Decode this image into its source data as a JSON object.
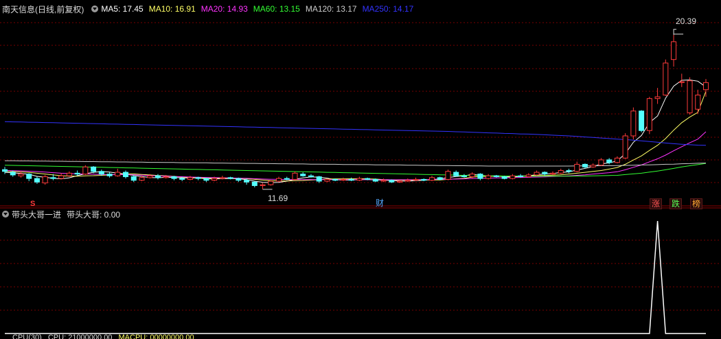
{
  "upper_header": {
    "title": "南天信息(日线,前复权)",
    "ma": [
      {
        "text": "MA5: 17.45",
        "color": "#ffffff"
      },
      {
        "text": "MA10: 16.91",
        "color": "#ffff66"
      },
      {
        "text": "MA20: 14.93",
        "color": "#ff33ff"
      },
      {
        "text": "MA60: 13.15",
        "color": "#33ff33"
      },
      {
        "text": "MA120: 13.17",
        "color": "#cccccc"
      },
      {
        "text": "MA250: 14.17",
        "color": "#3333ff"
      }
    ]
  },
  "price_labels": {
    "high": "20.39",
    "low": "11.69"
  },
  "event_tags": {
    "s": "S",
    "cai": "财",
    "zhang": "涨",
    "die": "跌",
    "bang": "榜"
  },
  "lower_header": {
    "title": "带头大哥一进",
    "value": "带头大哥: 0.00"
  },
  "bottom_row": {
    "items": [
      "CPU(30)",
      "CPU: 21000000.00",
      "MACPU: 00000000.00"
    ]
  },
  "colors": {
    "up": "#ff3b3b",
    "down": "#54ffff",
    "grid": "#7a0000",
    "border": "#8b0000"
  },
  "chart_data": {
    "type": "candlestick",
    "ohlc": [
      [
        12.8,
        12.7,
        12.95,
        12.55
      ],
      [
        12.65,
        12.5,
        12.75,
        12.4
      ],
      [
        12.45,
        12.55,
        12.7,
        12.35
      ],
      [
        12.55,
        12.3,
        12.6,
        12.15
      ],
      [
        12.3,
        12.1,
        12.4,
        12.0
      ],
      [
        12.05,
        12.4,
        12.5,
        11.95
      ],
      [
        12.35,
        12.3,
        12.55,
        12.2
      ],
      [
        12.3,
        12.45,
        12.6,
        12.25
      ],
      [
        12.45,
        12.6,
        12.7,
        12.4
      ],
      [
        12.6,
        12.55,
        12.75,
        12.45
      ],
      [
        12.55,
        12.95,
        13.05,
        12.5
      ],
      [
        12.95,
        12.7,
        13.0,
        12.6
      ],
      [
        12.7,
        12.55,
        12.8,
        12.45
      ],
      [
        12.55,
        12.45,
        12.65,
        12.35
      ],
      [
        12.45,
        12.65,
        12.85,
        12.4
      ],
      [
        12.65,
        12.4,
        12.75,
        12.3
      ],
      [
        12.4,
        12.2,
        12.5,
        12.1
      ],
      [
        12.2,
        12.35,
        12.45,
        12.15
      ],
      [
        12.35,
        12.45,
        12.55,
        12.3
      ],
      [
        12.45,
        12.35,
        12.55,
        12.25
      ],
      [
        12.35,
        12.4,
        12.5,
        12.3
      ],
      [
        12.4,
        12.3,
        12.45,
        12.2
      ],
      [
        12.3,
        12.25,
        12.4,
        12.15
      ],
      [
        12.25,
        12.35,
        12.45,
        12.2
      ],
      [
        12.35,
        12.3,
        12.4,
        12.2
      ],
      [
        12.3,
        12.2,
        12.35,
        12.1
      ],
      [
        12.2,
        12.3,
        12.4,
        12.15
      ],
      [
        12.3,
        12.35,
        12.45,
        12.25
      ],
      [
        12.35,
        12.3,
        12.4,
        12.25
      ],
      [
        12.3,
        12.2,
        12.35,
        12.1
      ],
      [
        12.2,
        12.1,
        12.3,
        11.95
      ],
      [
        12.1,
        11.9,
        12.15,
        11.8
      ],
      [
        11.9,
        11.95,
        12.05,
        11.69
      ],
      [
        11.95,
        12.15,
        12.2,
        11.9
      ],
      [
        12.15,
        12.3,
        12.4,
        12.1
      ],
      [
        12.3,
        12.25,
        12.4,
        12.2
      ],
      [
        12.25,
        12.6,
        12.7,
        12.2
      ],
      [
        12.55,
        12.45,
        12.65,
        12.4
      ],
      [
        12.45,
        12.4,
        12.55,
        12.35
      ],
      [
        12.4,
        12.15,
        12.45,
        12.05
      ],
      [
        12.15,
        12.25,
        12.3,
        12.1
      ],
      [
        12.25,
        12.2,
        12.3,
        12.15
      ],
      [
        12.2,
        12.25,
        12.35,
        12.15
      ],
      [
        12.25,
        12.2,
        12.35,
        12.15
      ],
      [
        12.2,
        12.3,
        12.4,
        12.15
      ],
      [
        12.3,
        12.25,
        12.35,
        12.2
      ],
      [
        12.25,
        12.15,
        12.3,
        12.1
      ],
      [
        12.15,
        12.2,
        12.3,
        12.1
      ],
      [
        12.2,
        12.1,
        12.25,
        12.05
      ],
      [
        12.1,
        12.15,
        12.2,
        12.05
      ],
      [
        12.15,
        12.2,
        12.3,
        12.1
      ],
      [
        12.2,
        12.25,
        12.35,
        12.15
      ],
      [
        12.25,
        12.2,
        12.3,
        12.15
      ],
      [
        12.2,
        12.35,
        12.45,
        12.15
      ],
      [
        12.35,
        12.25,
        12.4,
        12.2
      ],
      [
        12.25,
        12.7,
        12.8,
        12.2
      ],
      [
        12.65,
        12.45,
        12.75,
        12.4
      ],
      [
        12.45,
        12.4,
        12.55,
        12.35
      ],
      [
        12.4,
        12.55,
        12.65,
        12.3
      ],
      [
        12.55,
        12.3,
        12.6,
        12.2
      ],
      [
        12.3,
        12.45,
        12.55,
        12.25
      ],
      [
        12.45,
        12.4,
        12.5,
        12.35
      ],
      [
        12.4,
        12.3,
        12.45,
        12.25
      ],
      [
        12.3,
        12.45,
        12.55,
        12.25
      ],
      [
        12.45,
        12.4,
        12.55,
        12.35
      ],
      [
        12.4,
        12.5,
        12.6,
        12.35
      ],
      [
        12.5,
        12.65,
        12.75,
        12.45
      ],
      [
        12.65,
        12.55,
        12.7,
        12.45
      ],
      [
        12.55,
        12.6,
        12.7,
        12.5
      ],
      [
        12.6,
        12.75,
        12.85,
        12.55
      ],
      [
        12.75,
        12.7,
        12.85,
        12.6
      ],
      [
        12.7,
        13.1,
        13.25,
        12.65
      ],
      [
        13.1,
        12.95,
        13.15,
        12.85
      ],
      [
        12.95,
        13.05,
        13.15,
        12.9
      ],
      [
        13.05,
        13.35,
        13.45,
        13.0
      ],
      [
        13.35,
        13.2,
        13.45,
        13.1
      ],
      [
        13.2,
        13.45,
        13.55,
        13.15
      ],
      [
        13.45,
        14.7,
        14.85,
        13.4
      ],
      [
        14.7,
        16.1,
        16.3,
        14.5
      ],
      [
        16.1,
        15.0,
        16.15,
        14.9
      ],
      [
        15.0,
        16.8,
        16.9,
        14.8
      ],
      [
        16.8,
        16.9,
        17.4,
        16.5
      ],
      [
        17.0,
        18.8,
        19.0,
        16.95
      ],
      [
        19.0,
        20.0,
        20.39,
        18.6
      ],
      [
        17.7,
        17.75,
        18.2,
        17.45
      ],
      [
        16.0,
        17.8,
        18.0,
        15.9
      ],
      [
        16.2,
        17.0,
        17.3,
        15.95
      ],
      [
        17.3,
        17.7,
        17.9,
        16.9
      ]
    ],
    "ma_series": [
      {
        "name": "MA5",
        "values": [
          12.65,
          12.62,
          12.58,
          12.54,
          12.42,
          12.37,
          12.31,
          12.28,
          12.34,
          12.46,
          12.57,
          12.65,
          12.69,
          12.66,
          12.6,
          12.55,
          12.47,
          12.41,
          12.36,
          12.34,
          12.37,
          12.36,
          12.34,
          12.33,
          12.33,
          12.28,
          12.28,
          12.29,
          12.3,
          12.29,
          12.23,
          12.15,
          12.09,
          12.07,
          12.08,
          12.15,
          12.26,
          12.33,
          12.39,
          12.37,
          12.32,
          12.23,
          12.21,
          12.21,
          12.24,
          12.24,
          12.22,
          12.21,
          12.19,
          12.16,
          12.15,
          12.18,
          12.2,
          12.25,
          12.27,
          12.36,
          12.41,
          12.45,
          12.53,
          12.49,
          12.44,
          12.45,
          12.4,
          12.38,
          12.42,
          12.45,
          12.52,
          12.55,
          12.58,
          12.64,
          12.67,
          12.78,
          12.87,
          12.97,
          13.12,
          13.18,
          13.29,
          13.7,
          14.34,
          14.72,
          15.45,
          15.82,
          16.82,
          17.5,
          17.83,
          17.85,
          17.78,
          17.45
        ]
      },
      {
        "name": "MA10",
        "values": [
          12.7,
          12.69,
          12.67,
          12.64,
          12.6,
          12.55,
          12.5,
          12.46,
          12.43,
          12.43,
          12.45,
          12.46,
          12.48,
          12.5,
          12.53,
          12.56,
          12.56,
          12.53,
          12.5,
          12.47,
          12.45,
          12.42,
          12.38,
          12.35,
          12.34,
          12.32,
          12.31,
          12.31,
          12.31,
          12.31,
          12.29,
          12.25,
          12.21,
          12.18,
          12.16,
          12.16,
          12.18,
          12.19,
          12.21,
          12.24,
          12.27,
          12.28,
          12.28,
          12.29,
          12.29,
          12.28,
          12.27,
          12.24,
          12.22,
          12.21,
          12.21,
          12.21,
          12.21,
          12.22,
          12.22,
          12.25,
          12.28,
          12.31,
          12.38,
          12.41,
          12.42,
          12.43,
          12.42,
          12.43,
          12.44,
          12.45,
          12.47,
          12.47,
          12.49,
          12.51,
          12.55,
          12.6,
          12.65,
          12.7,
          12.75,
          12.83,
          12.92,
          13.1,
          13.34,
          13.57,
          13.88,
          14.17,
          14.55,
          15.02,
          15.44,
          15.76,
          16.02,
          17.21
        ]
      },
      {
        "name": "MA20",
        "values": [
          12.75,
          12.74,
          12.73,
          12.71,
          12.69,
          12.66,
          12.63,
          12.6,
          12.58,
          12.56,
          12.55,
          12.54,
          12.53,
          12.52,
          12.52,
          12.52,
          12.51,
          12.49,
          12.47,
          12.45,
          12.43,
          12.41,
          12.4,
          12.38,
          12.37,
          12.36,
          12.35,
          12.34,
          12.33,
          12.32,
          12.31,
          12.29,
          12.27,
          12.26,
          12.25,
          12.24,
          12.24,
          12.24,
          12.24,
          12.24,
          12.24,
          12.24,
          12.24,
          12.24,
          12.24,
          12.24,
          12.24,
          12.23,
          12.23,
          12.23,
          12.23,
          12.23,
          12.24,
          12.24,
          12.25,
          12.26,
          12.27,
          12.28,
          12.3,
          12.31,
          12.32,
          12.33,
          12.34,
          12.35,
          12.36,
          12.37,
          12.38,
          12.39,
          12.41,
          12.43,
          12.45,
          12.48,
          12.51,
          12.55,
          12.59,
          12.63,
          12.68,
          12.79,
          12.93,
          13.06,
          13.24,
          13.41,
          13.62,
          13.86,
          14.09,
          14.31,
          14.52,
          14.93
        ]
      },
      {
        "name": "MA60",
        "values": [
          13.05,
          13.04,
          13.03,
          13.02,
          13.01,
          13.0,
          12.99,
          12.98,
          12.97,
          12.96,
          12.95,
          12.94,
          12.93,
          12.92,
          12.91,
          12.9,
          12.89,
          12.88,
          12.87,
          12.86,
          12.85,
          12.84,
          12.83,
          12.82,
          12.81,
          12.8,
          12.79,
          12.78,
          12.77,
          12.76,
          12.75,
          12.74,
          12.73,
          12.72,
          12.71,
          12.7,
          12.69,
          12.68,
          12.67,
          12.66,
          12.65,
          12.64,
          12.63,
          12.62,
          12.61,
          12.6,
          12.59,
          12.58,
          12.57,
          12.56,
          12.55,
          12.54,
          12.53,
          12.52,
          12.51,
          12.5,
          12.49,
          12.48,
          12.47,
          12.46,
          12.45,
          12.45,
          12.44,
          12.44,
          12.43,
          12.43,
          12.43,
          12.43,
          12.43,
          12.43,
          12.43,
          12.44,
          12.44,
          12.45,
          12.46,
          12.47,
          12.48,
          12.52,
          12.56,
          12.6,
          12.66,
          12.72,
          12.79,
          12.87,
          12.95,
          13.02,
          13.08,
          13.15
        ]
      },
      {
        "name": "MA120",
        "values": [
          13.3,
          13.3,
          13.29,
          13.29,
          13.28,
          13.28,
          13.27,
          13.27,
          13.26,
          13.26,
          13.25,
          13.25,
          13.24,
          13.24,
          13.23,
          13.23,
          13.22,
          13.22,
          13.21,
          13.21,
          13.2,
          13.2,
          13.19,
          13.19,
          13.18,
          13.18,
          13.17,
          13.17,
          13.16,
          13.16,
          13.15,
          13.15,
          13.14,
          13.14,
          13.13,
          13.13,
          13.12,
          13.12,
          13.11,
          13.11,
          13.1,
          13.1,
          13.09,
          13.09,
          13.08,
          13.08,
          13.07,
          13.07,
          13.06,
          13.06,
          13.05,
          13.05,
          13.04,
          13.04,
          13.03,
          13.03,
          13.02,
          13.02,
          13.01,
          13.01,
          13.0,
          13.0,
          13.0,
          13.0,
          13.0,
          13.0,
          13.0,
          13.0,
          13.0,
          13.0,
          13.0,
          13.01,
          13.01,
          13.01,
          13.02,
          13.02,
          13.03,
          13.04,
          13.05,
          13.06,
          13.07,
          13.08,
          13.1,
          13.11,
          13.13,
          13.14,
          13.16,
          13.17
        ]
      },
      {
        "name": "MA250",
        "values": [
          15.5,
          15.49,
          15.48,
          15.47,
          15.46,
          15.45,
          15.44,
          15.43,
          15.42,
          15.41,
          15.4,
          15.39,
          15.38,
          15.37,
          15.36,
          15.35,
          15.34,
          15.33,
          15.32,
          15.31,
          15.3,
          15.29,
          15.28,
          15.27,
          15.26,
          15.25,
          15.24,
          15.23,
          15.22,
          15.21,
          15.2,
          15.19,
          15.18,
          15.17,
          15.16,
          15.15,
          15.14,
          15.13,
          15.12,
          15.11,
          15.1,
          15.09,
          15.08,
          15.07,
          15.06,
          15.05,
          15.04,
          15.03,
          15.02,
          15.01,
          15.0,
          14.99,
          14.98,
          14.97,
          14.96,
          14.95,
          14.93,
          14.92,
          14.9,
          14.89,
          14.87,
          14.86,
          14.84,
          14.83,
          14.81,
          14.8,
          14.78,
          14.76,
          14.74,
          14.72,
          14.7,
          14.67,
          14.64,
          14.61,
          14.58,
          14.55,
          14.52,
          14.49,
          14.46,
          14.42,
          14.38,
          14.34,
          14.3,
          14.26,
          14.23,
          14.2,
          14.18,
          14.17
        ]
      }
    ],
    "indicator": {
      "name": "带头大哥",
      "values": [
        0,
        0,
        0,
        0,
        0,
        0,
        0,
        0,
        0,
        0,
        0,
        0,
        0,
        0,
        0,
        0,
        0,
        0,
        0,
        0,
        0,
        0,
        0,
        0,
        0,
        0,
        0,
        0,
        0,
        0,
        0,
        0,
        0,
        0,
        0,
        0,
        0,
        0,
        0,
        0,
        0,
        0,
        0,
        0,
        0,
        0,
        0,
        0,
        0,
        0,
        0,
        0,
        0,
        0,
        0,
        0,
        0,
        0,
        0,
        0,
        0,
        0,
        0,
        0,
        0,
        0,
        0,
        0,
        0,
        0,
        0,
        0,
        0,
        0,
        0,
        0,
        0,
        0,
        0,
        0,
        0,
        1,
        0,
        0,
        0,
        0,
        0,
        0
      ]
    },
    "ylim": [
      11.3,
      21.5
    ]
  }
}
